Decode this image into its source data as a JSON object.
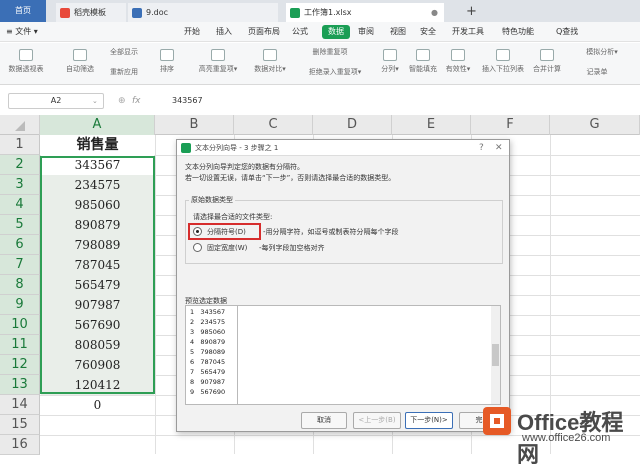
{
  "tabs": {
    "home": "首页",
    "templates": "稻壳模板",
    "doc": "9.doc",
    "workbook": "工作簿1.xlsx"
  },
  "menu": [
    "≡ 文件 ▾",
    "开始",
    "插入",
    "页面布局",
    "公式",
    "数据",
    "审阅",
    "视图",
    "安全",
    "开发工具",
    "特色功能",
    "Q查找"
  ],
  "ribbon": {
    "items": [
      "数据透视表",
      "自动筛选",
      "全部显示",
      "重新应用",
      "排序",
      "高亮重复项▾",
      "数据对比▾",
      "删除重复项",
      "拒绝录入重复项▾",
      "分列▾",
      "智能填充",
      "有效性▾",
      "插入下拉列表",
      "合并计算",
      "模拟分析▾",
      "记录单"
    ]
  },
  "formula_bar": {
    "name_box": "A2",
    "fx": "fx",
    "value": "343567"
  },
  "columns": [
    "A",
    "B",
    "C",
    "D",
    "E",
    "F",
    "G"
  ],
  "rows": [
    "1",
    "2",
    "3",
    "4",
    "5",
    "6",
    "7",
    "8",
    "9",
    "10",
    "11",
    "12",
    "13",
    "14",
    "15",
    "16"
  ],
  "column_a": [
    "销售量",
    "343567",
    "234575",
    "985060",
    "890879",
    "798089",
    "787045",
    "565479",
    "907987",
    "567690",
    "808059",
    "760908",
    "120412",
    "0"
  ],
  "dialog": {
    "title": "文本分列向导 - 3 步骤之 1",
    "intro1": "文本分列向导判定您的数据有分隔符。",
    "intro2": "若一切设置无误，请单击“下一步”，否则请选择最合适的数据类型。",
    "group_label": "原始数据类型",
    "choose_label": "请选择最合适的文件类型:",
    "opt_delimited": "分隔符号(D)",
    "opt_delimited_desc": "-用分隔字符，如逗号或制表符分隔每个字段",
    "opt_fixed": "固定宽度(W)",
    "opt_fixed_desc": "-每列字段加空格对齐",
    "preview_label": "预览选定数据",
    "preview_rows": [
      [
        "1",
        "343567"
      ],
      [
        "2",
        "234575"
      ],
      [
        "3",
        "985060"
      ],
      [
        "4",
        "890879"
      ],
      [
        "5",
        "798089"
      ],
      [
        "6",
        "787045"
      ],
      [
        "7",
        "565479"
      ],
      [
        "8",
        "907987"
      ],
      [
        "9",
        "567690"
      ]
    ],
    "btn_cancel": "取消",
    "btn_prev": "<上一步(B)",
    "btn_next": "下一步(N)>",
    "btn_finish": "完"
  },
  "watermark": {
    "name": "Office教程网",
    "url": "www.office26.com"
  }
}
